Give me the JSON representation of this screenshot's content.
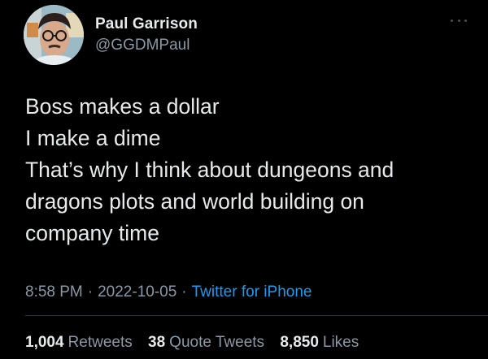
{
  "author": {
    "name": "Paul Garrison",
    "handle": "@GGDMPaul"
  },
  "tweet": {
    "lines": [
      "Boss makes a dollar",
      "I make a dime",
      "That’s why I think about dungeons and",
      "dragons plots and world building on",
      "company time"
    ]
  },
  "meta": {
    "time": "8:58 PM",
    "separator": "·",
    "date": "2022-10-05",
    "source": "Twitter for iPhone"
  },
  "stats": {
    "retweets": {
      "count": "1,004",
      "label": "Retweets"
    },
    "quotes": {
      "count": "38",
      "label": "Quote Tweets"
    },
    "likes": {
      "count": "8,850",
      "label": "Likes"
    }
  },
  "icons": {
    "more": "more-horizontal-icon"
  },
  "colors": {
    "background": "#000000",
    "primary_text": "#e7e9ea",
    "secondary_text": "#8b98a5",
    "link": "#1d9bf0",
    "divider": "#2f3336"
  }
}
